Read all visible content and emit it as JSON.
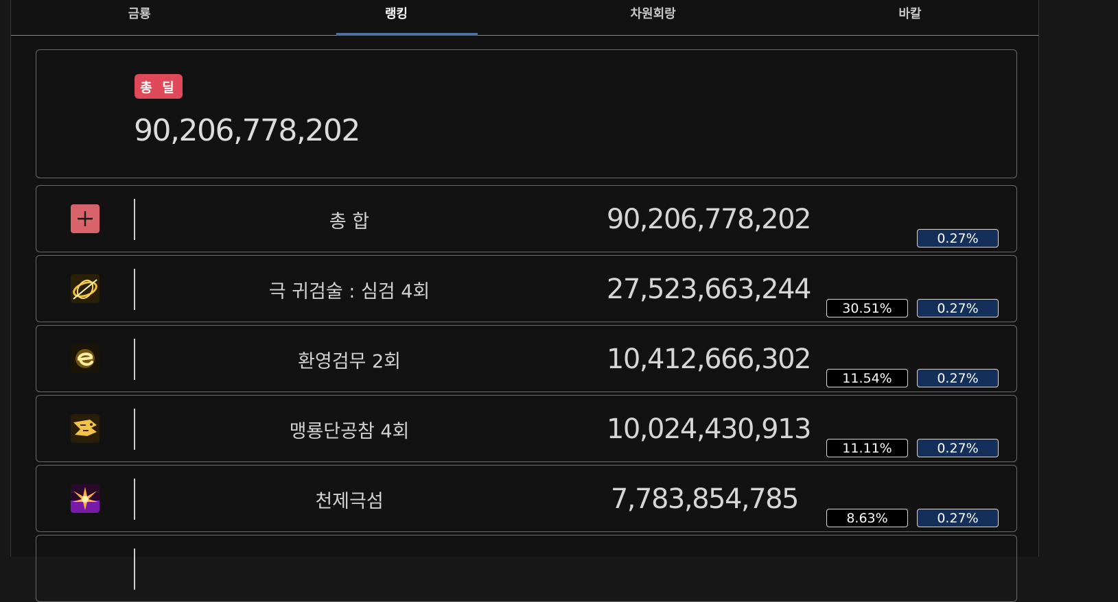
{
  "tabs": [
    {
      "label": "금룡",
      "active": false
    },
    {
      "label": "랭킹",
      "active": true
    },
    {
      "label": "차원회랑",
      "active": false
    },
    {
      "label": "바칼",
      "active": false
    }
  ],
  "total_card": {
    "badge": "총 딜",
    "value": "90,206,778,202"
  },
  "rows": [
    {
      "icon": "plus-icon",
      "name": "총 합",
      "value": "90,206,778,202",
      "share": "",
      "rate": "0.27%"
    },
    {
      "icon": "sword-ring-skill-icon",
      "name": "극 귀검술 : 심검 4회",
      "value": "27,523,663,244",
      "share": "30.51%",
      "rate": "0.27%"
    },
    {
      "icon": "phantom-dance-skill-icon",
      "name": "환영검무 2회",
      "value": "10,412,666,302",
      "share": "11.54%",
      "rate": "0.27%"
    },
    {
      "icon": "dragon-slash-skill-icon",
      "name": "맹룡단공참 4회",
      "value": "10,024,430,913",
      "share": "11.11%",
      "rate": "0.27%"
    },
    {
      "icon": "heavenly-flash-skill-icon",
      "name": "천제극섬",
      "value": "7,783,854,785",
      "share": "8.63%",
      "rate": "0.27%"
    }
  ],
  "colors": {
    "badge": "#e0495a",
    "active_tab_underline": "#4e6fa3",
    "rate_badge_bg": "#14305a",
    "plus_box": "#d9636b"
  }
}
